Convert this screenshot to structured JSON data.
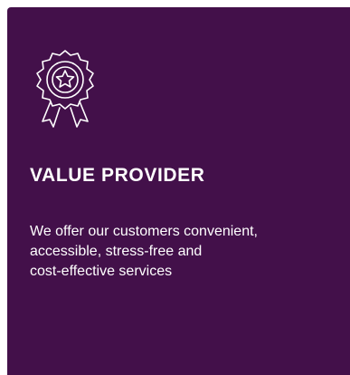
{
  "card": {
    "background_color": "#43104a",
    "icon": "award-ribbon-icon",
    "title": "VALUE PROVIDER",
    "description_lines": [
      "We offer our customers convenient,",
      "accessible, stress-free and",
      "cost-effective services"
    ]
  }
}
